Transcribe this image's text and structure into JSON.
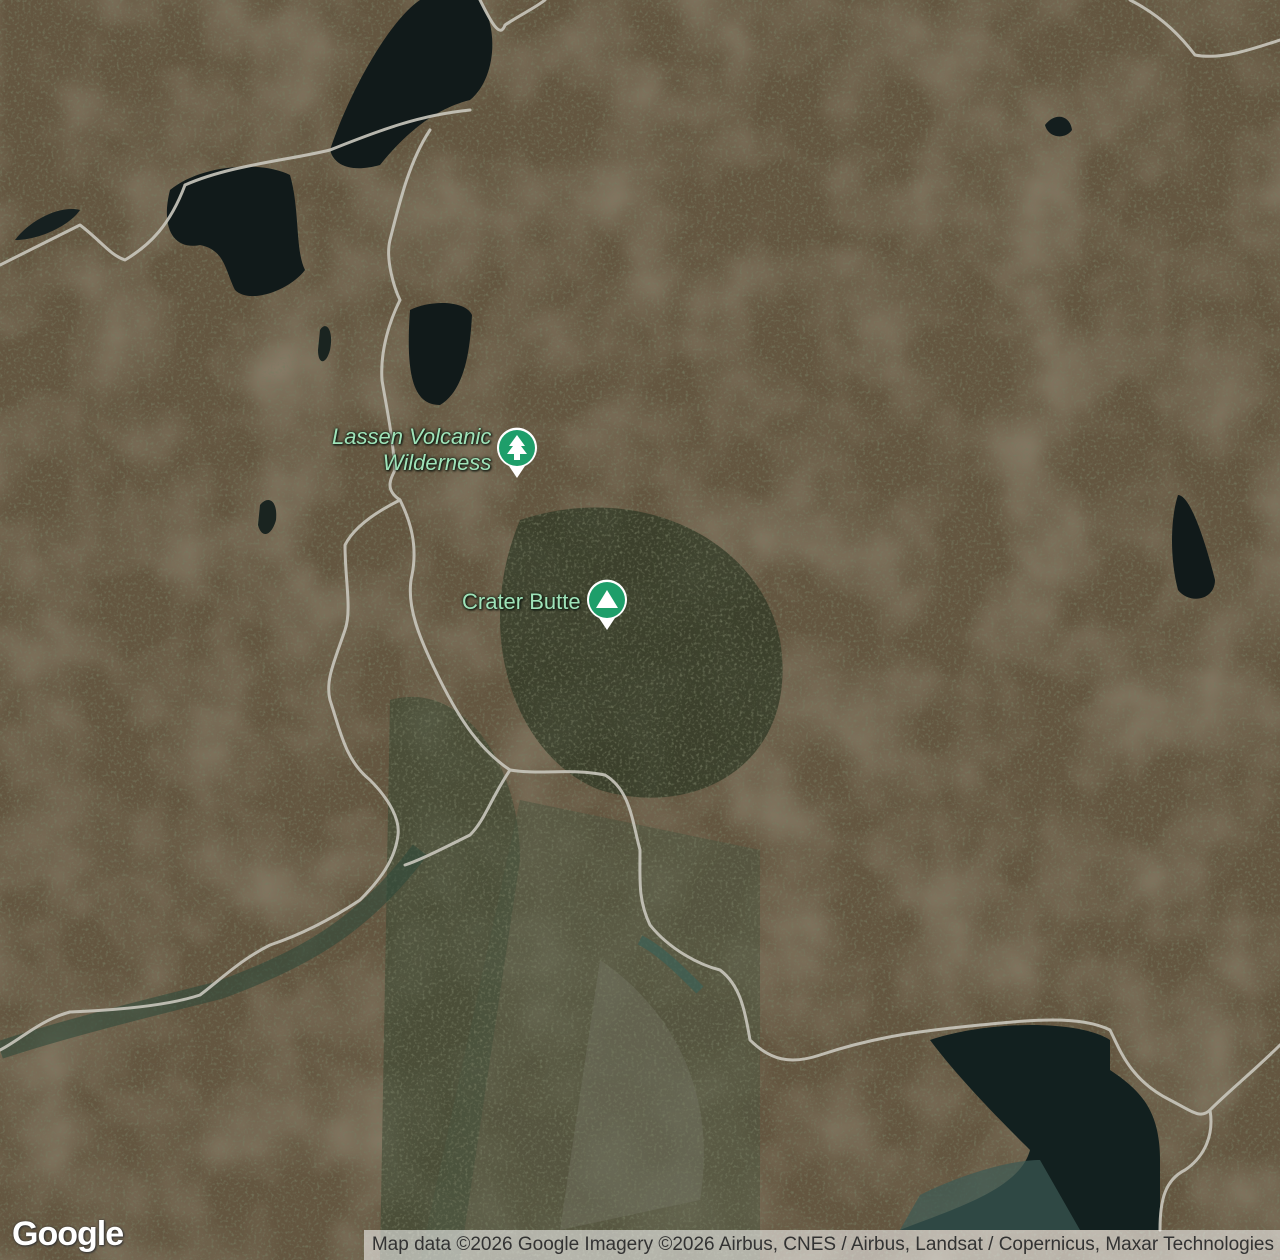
{
  "map": {
    "type": "satellite",
    "pois": [
      {
        "label_line1": "Lassen Volcanic",
        "label_line2": "Wilderness",
        "icon": "tree-icon",
        "color": "#1e9e6a"
      },
      {
        "label": "Crater Butte",
        "icon": "mountain-icon",
        "color": "#1e9e6a"
      }
    ]
  },
  "branding": {
    "logo_text": "Google"
  },
  "attribution": {
    "text": "Map data ©2026 Google Imagery ©2026 Airbus, CNES / Airbus, Landsat / Copernicus, Maxar Technologies"
  }
}
